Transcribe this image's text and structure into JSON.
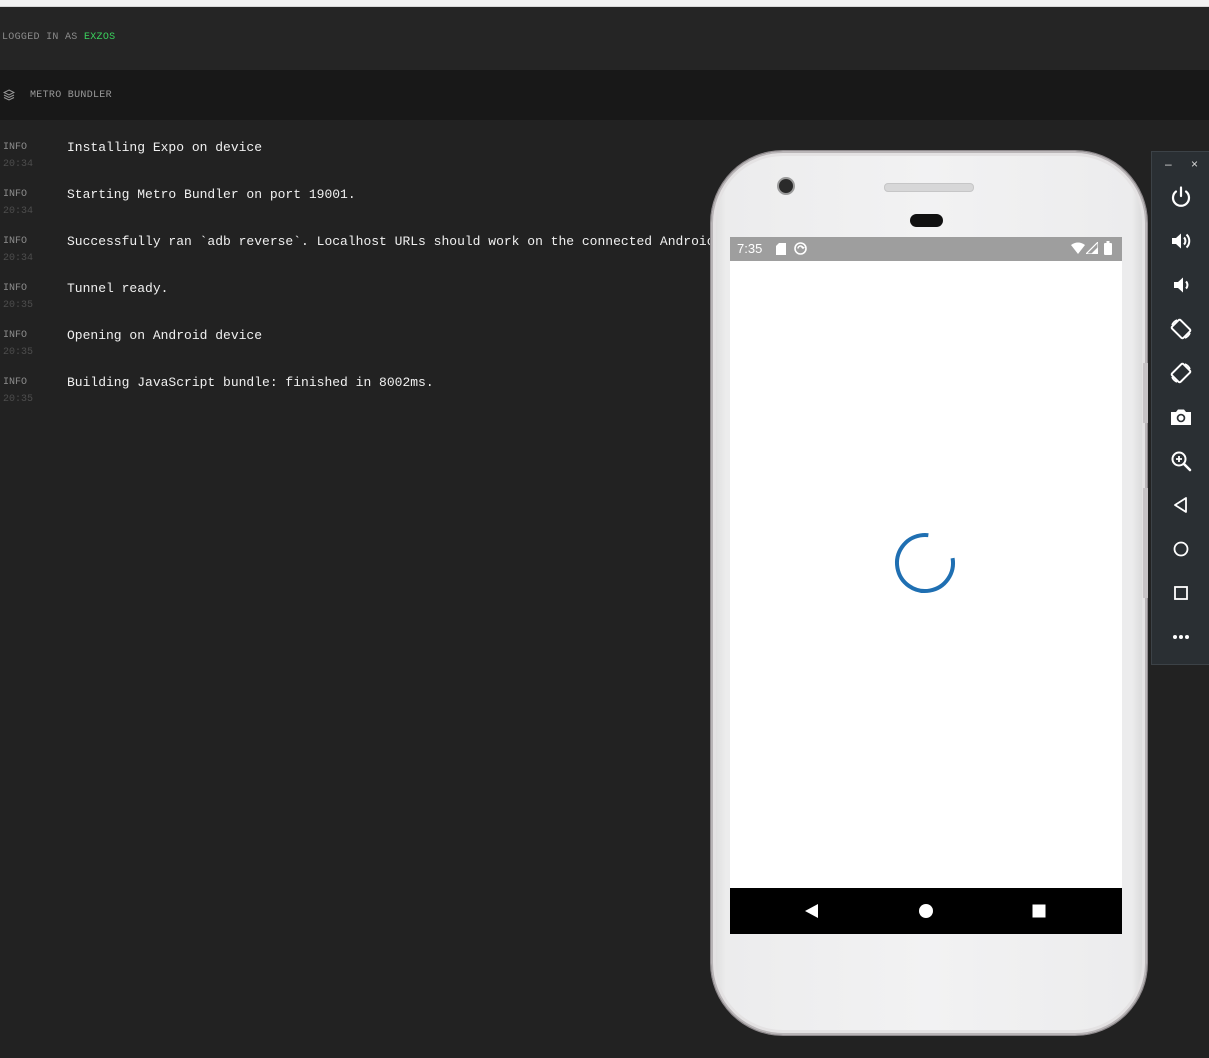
{
  "header": {
    "login_prefix": "LOGGED IN AS",
    "username": "EXZOS"
  },
  "panel": {
    "title": "METRO BUNDLER",
    "icon": "stack-icon"
  },
  "logs": [
    {
      "level": "INFO",
      "time": "20:34",
      "message": "Installing Expo on device"
    },
    {
      "level": "INFO",
      "time": "20:34",
      "message": "Starting Metro Bundler on port 19001."
    },
    {
      "level": "INFO",
      "time": "20:34",
      "message": "Successfully ran `adb reverse`. Localhost URLs should work on the connected Androic"
    },
    {
      "level": "INFO",
      "time": "20:35",
      "message": "Tunnel ready."
    },
    {
      "level": "INFO",
      "time": "20:35",
      "message": "Opening on Android device"
    },
    {
      "level": "INFO",
      "time": "20:35",
      "message": "Building JavaScript bundle: finished in 8002ms."
    }
  ],
  "emulator": {
    "status_time": "7:35",
    "status_icons": [
      "sd-card-icon",
      "sync-icon",
      "wifi-icon",
      "signal-icon",
      "battery-icon"
    ],
    "loading": true,
    "spinner_color": "#1f6fb2",
    "nav_buttons": [
      "back-icon",
      "home-icon",
      "recents-icon"
    ]
  },
  "toolbar": {
    "window_controls": {
      "minimize": "–",
      "close": "×"
    },
    "buttons": [
      "power-icon",
      "volume-up-icon",
      "volume-down-icon",
      "rotate-left-icon",
      "rotate-right-icon",
      "camera-icon",
      "zoom-icon",
      "back-icon",
      "home-icon",
      "overview-icon",
      "more-icon"
    ]
  },
  "colors": {
    "username": "#3ad25d",
    "background": "#222222",
    "toolbar": "#2a2f33"
  }
}
